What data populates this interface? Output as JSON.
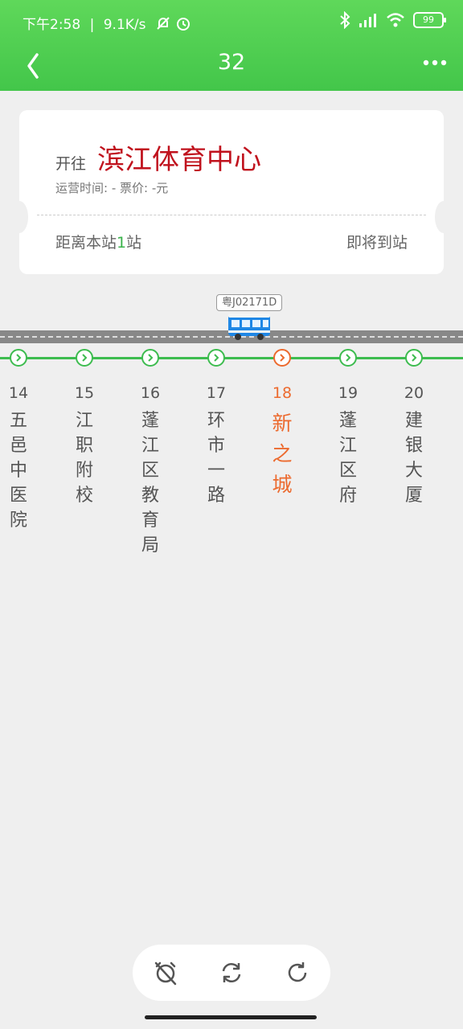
{
  "status_bar": {
    "time": "下午2:58",
    "network_speed": "9.1K/s",
    "battery": "99",
    "icons": [
      "mute-bell-icon",
      "alarm-icon",
      "bluetooth-icon",
      "signal-icon",
      "wifi-icon",
      "battery-icon"
    ]
  },
  "header": {
    "title": "32",
    "back_icon": "chevron-left-icon",
    "more_icon": "more-dots-icon"
  },
  "card": {
    "direction_prefix": "开往",
    "destination": "滨江体育中心",
    "info": "运营时间: - 票价: -元",
    "distance_prefix": "距离本站",
    "distance_count": "1",
    "distance_suffix": "站",
    "arrival_status": "即将到站"
  },
  "bus": {
    "plate": "粤J02171D",
    "icon": "bus-icon"
  },
  "stops": [
    {
      "number": "14",
      "name": "五邑中医院"
    },
    {
      "number": "15",
      "name": "江职附校"
    },
    {
      "number": "16",
      "name": "蓬江区教育局"
    },
    {
      "number": "17",
      "name": "环市一路"
    },
    {
      "number": "18",
      "name": "新之城",
      "current": true
    },
    {
      "number": "19",
      "name": "蓬江区府"
    },
    {
      "number": "20",
      "name": "建银大厦"
    }
  ],
  "controls": {
    "icons": [
      "alarm-off-icon",
      "swap-direction-icon",
      "refresh-icon"
    ]
  },
  "colors": {
    "header_green": "#43c64a",
    "route_green": "#3dbc4f",
    "destination_red": "#c0121d",
    "current_orange": "#ec6a2e"
  }
}
